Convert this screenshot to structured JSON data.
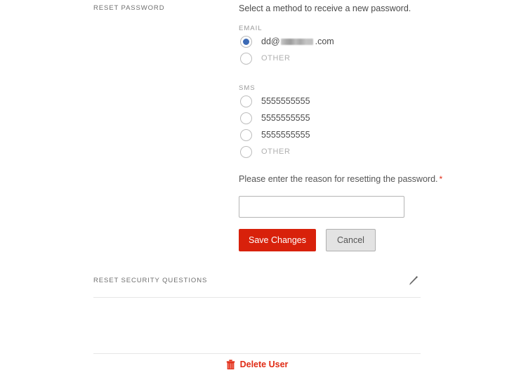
{
  "reset_password": {
    "section_label": "RESET PASSWORD",
    "intro": "Select a method to receive a new password.",
    "email": {
      "group_title": "EMAIL",
      "options": [
        {
          "label_prefix": "dd@",
          "label_suffix": ".com",
          "redacted": true,
          "selected": true
        },
        {
          "label_prefix": "OTHER",
          "label_suffix": "",
          "redacted": false,
          "selected": false
        }
      ]
    },
    "sms": {
      "group_title": "SMS",
      "options": [
        {
          "label": "5555555555",
          "selected": false
        },
        {
          "label": "5555555555",
          "selected": false
        },
        {
          "label": "5555555555",
          "selected": false
        },
        {
          "label": "OTHER",
          "selected": false
        }
      ]
    },
    "reason": {
      "label": "Please enter the reason for resetting the password.",
      "required_marker": "*",
      "value": "",
      "placeholder": ""
    },
    "buttons": {
      "save": "Save Changes",
      "cancel": "Cancel"
    }
  },
  "security_questions": {
    "section_label": "RESET SECURITY QUESTIONS",
    "edit_icon": "pencil-icon"
  },
  "footer": {
    "delete_label": "Delete User",
    "delete_icon": "trash-icon"
  },
  "colors": {
    "accent_red": "#d8210b",
    "danger_red": "#e02b15",
    "radio_blue": "#3c6ab5",
    "label_gray": "#6f6f6f",
    "muted_gray": "#b0b0b0",
    "divider_gray": "#e6e6e6"
  }
}
